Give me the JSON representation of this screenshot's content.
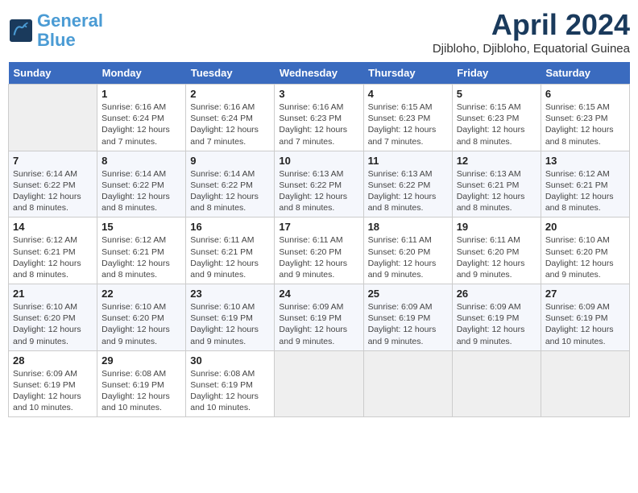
{
  "header": {
    "logo_line1": "General",
    "logo_line2": "Blue",
    "month": "April 2024",
    "location": "Djibloho, Djibloho, Equatorial Guinea"
  },
  "days_of_week": [
    "Sunday",
    "Monday",
    "Tuesday",
    "Wednesday",
    "Thursday",
    "Friday",
    "Saturday"
  ],
  "weeks": [
    [
      {
        "day": "",
        "info": ""
      },
      {
        "day": "1",
        "info": "Sunrise: 6:16 AM\nSunset: 6:24 PM\nDaylight: 12 hours\nand 7 minutes."
      },
      {
        "day": "2",
        "info": "Sunrise: 6:16 AM\nSunset: 6:24 PM\nDaylight: 12 hours\nand 7 minutes."
      },
      {
        "day": "3",
        "info": "Sunrise: 6:16 AM\nSunset: 6:23 PM\nDaylight: 12 hours\nand 7 minutes."
      },
      {
        "day": "4",
        "info": "Sunrise: 6:15 AM\nSunset: 6:23 PM\nDaylight: 12 hours\nand 7 minutes."
      },
      {
        "day": "5",
        "info": "Sunrise: 6:15 AM\nSunset: 6:23 PM\nDaylight: 12 hours\nand 8 minutes."
      },
      {
        "day": "6",
        "info": "Sunrise: 6:15 AM\nSunset: 6:23 PM\nDaylight: 12 hours\nand 8 minutes."
      }
    ],
    [
      {
        "day": "7",
        "info": "Sunrise: 6:14 AM\nSunset: 6:22 PM\nDaylight: 12 hours\nand 8 minutes."
      },
      {
        "day": "8",
        "info": "Sunrise: 6:14 AM\nSunset: 6:22 PM\nDaylight: 12 hours\nand 8 minutes."
      },
      {
        "day": "9",
        "info": "Sunrise: 6:14 AM\nSunset: 6:22 PM\nDaylight: 12 hours\nand 8 minutes."
      },
      {
        "day": "10",
        "info": "Sunrise: 6:13 AM\nSunset: 6:22 PM\nDaylight: 12 hours\nand 8 minutes."
      },
      {
        "day": "11",
        "info": "Sunrise: 6:13 AM\nSunset: 6:22 PM\nDaylight: 12 hours\nand 8 minutes."
      },
      {
        "day": "12",
        "info": "Sunrise: 6:13 AM\nSunset: 6:21 PM\nDaylight: 12 hours\nand 8 minutes."
      },
      {
        "day": "13",
        "info": "Sunrise: 6:12 AM\nSunset: 6:21 PM\nDaylight: 12 hours\nand 8 minutes."
      }
    ],
    [
      {
        "day": "14",
        "info": "Sunrise: 6:12 AM\nSunset: 6:21 PM\nDaylight: 12 hours\nand 8 minutes."
      },
      {
        "day": "15",
        "info": "Sunrise: 6:12 AM\nSunset: 6:21 PM\nDaylight: 12 hours\nand 8 minutes."
      },
      {
        "day": "16",
        "info": "Sunrise: 6:11 AM\nSunset: 6:21 PM\nDaylight: 12 hours\nand 9 minutes."
      },
      {
        "day": "17",
        "info": "Sunrise: 6:11 AM\nSunset: 6:20 PM\nDaylight: 12 hours\nand 9 minutes."
      },
      {
        "day": "18",
        "info": "Sunrise: 6:11 AM\nSunset: 6:20 PM\nDaylight: 12 hours\nand 9 minutes."
      },
      {
        "day": "19",
        "info": "Sunrise: 6:11 AM\nSunset: 6:20 PM\nDaylight: 12 hours\nand 9 minutes."
      },
      {
        "day": "20",
        "info": "Sunrise: 6:10 AM\nSunset: 6:20 PM\nDaylight: 12 hours\nand 9 minutes."
      }
    ],
    [
      {
        "day": "21",
        "info": "Sunrise: 6:10 AM\nSunset: 6:20 PM\nDaylight: 12 hours\nand 9 minutes."
      },
      {
        "day": "22",
        "info": "Sunrise: 6:10 AM\nSunset: 6:20 PM\nDaylight: 12 hours\nand 9 minutes."
      },
      {
        "day": "23",
        "info": "Sunrise: 6:10 AM\nSunset: 6:19 PM\nDaylight: 12 hours\nand 9 minutes."
      },
      {
        "day": "24",
        "info": "Sunrise: 6:09 AM\nSunset: 6:19 PM\nDaylight: 12 hours\nand 9 minutes."
      },
      {
        "day": "25",
        "info": "Sunrise: 6:09 AM\nSunset: 6:19 PM\nDaylight: 12 hours\nand 9 minutes."
      },
      {
        "day": "26",
        "info": "Sunrise: 6:09 AM\nSunset: 6:19 PM\nDaylight: 12 hours\nand 9 minutes."
      },
      {
        "day": "27",
        "info": "Sunrise: 6:09 AM\nSunset: 6:19 PM\nDaylight: 12 hours\nand 10 minutes."
      }
    ],
    [
      {
        "day": "28",
        "info": "Sunrise: 6:09 AM\nSunset: 6:19 PM\nDaylight: 12 hours\nand 10 minutes."
      },
      {
        "day": "29",
        "info": "Sunrise: 6:08 AM\nSunset: 6:19 PM\nDaylight: 12 hours\nand 10 minutes."
      },
      {
        "day": "30",
        "info": "Sunrise: 6:08 AM\nSunset: 6:19 PM\nDaylight: 12 hours\nand 10 minutes."
      },
      {
        "day": "",
        "info": ""
      },
      {
        "day": "",
        "info": ""
      },
      {
        "day": "",
        "info": ""
      },
      {
        "day": "",
        "info": ""
      }
    ]
  ]
}
